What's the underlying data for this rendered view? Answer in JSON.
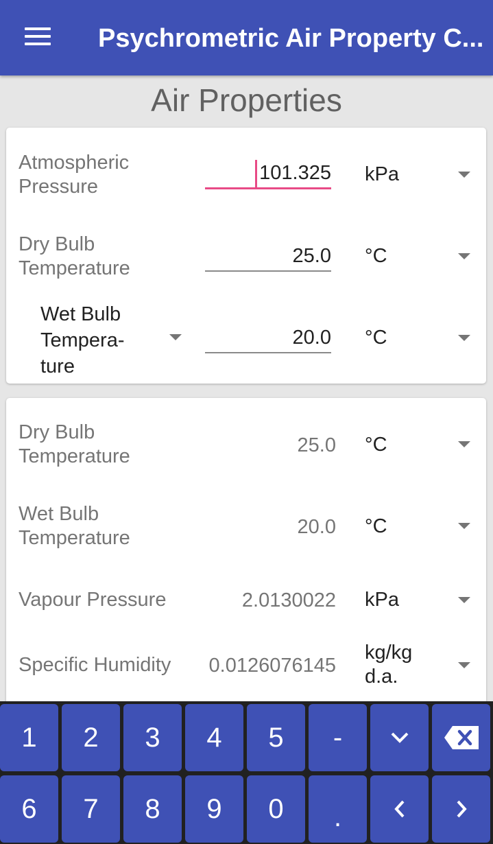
{
  "appbar": {
    "title": "Psychrometric Air Property C..."
  },
  "page": {
    "title": "Air Properties"
  },
  "inputs": {
    "atmospheric_pressure": {
      "label": "Atmospheric Pressure",
      "value": "101.325",
      "unit": "kPa"
    },
    "dry_bulb": {
      "label": "Dry Bulb Temperature",
      "value": "25.0",
      "unit": "°C"
    },
    "wet_bulb": {
      "label": "Wet Bulb Tempera-ture",
      "value": "20.0",
      "unit": "°C"
    }
  },
  "results": {
    "dry_bulb": {
      "label": "Dry Bulb Temperature",
      "value": "25.0",
      "unit": "°C"
    },
    "wet_bulb": {
      "label": "Wet Bulb Temperature",
      "value": "20.0",
      "unit": "°C"
    },
    "vapour_pressure": {
      "label": "Vapour Pressure",
      "value": "2.0130022",
      "unit": "kPa"
    },
    "specific_humidity": {
      "label": "Specific Humidity",
      "value": "0.0126076145",
      "unit": "kg/kg d.a."
    }
  },
  "keyboard": {
    "row1": [
      "1",
      "2",
      "3",
      "4",
      "5",
      "-"
    ],
    "row2": [
      "6",
      "7",
      "8",
      "9",
      "0",
      "."
    ]
  },
  "colors": {
    "primary": "#3f51b5",
    "accent": "#e84a86",
    "keyboard_bg": "#212121"
  }
}
